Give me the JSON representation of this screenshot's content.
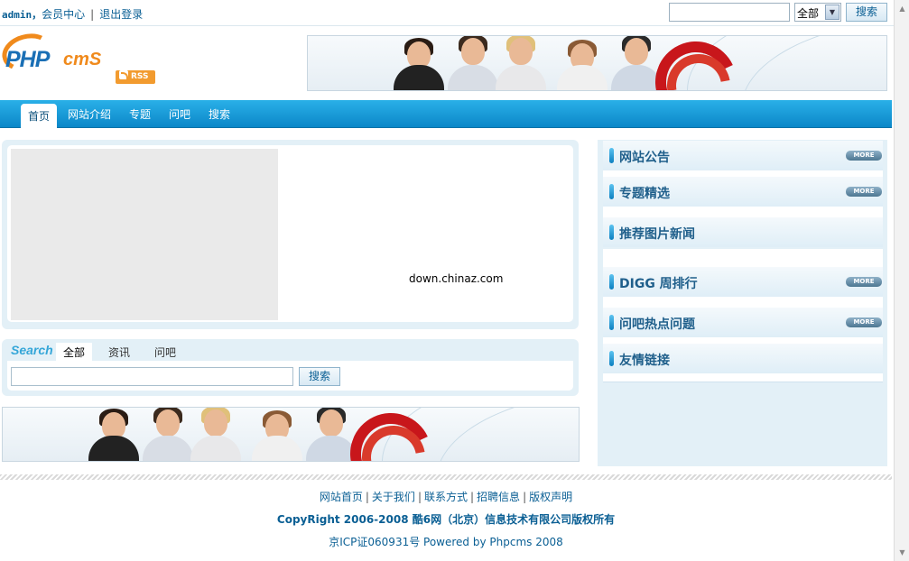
{
  "topbar": {
    "username": "admin，",
    "member_center": "会员中心",
    "separator": "|",
    "logout": "退出登录",
    "search_value": "",
    "scope_select": "全部",
    "search_button": "搜索"
  },
  "header": {
    "logo_php": "PHP",
    "logo_cms": "cmS",
    "rss_label": "RSS"
  },
  "nav": {
    "tabs": [
      "首页",
      "网站介绍",
      "专题",
      "问吧",
      "搜索"
    ],
    "active": "首页"
  },
  "slide": {
    "watermark": "down.chinaz.com"
  },
  "search": {
    "title": "Search",
    "tabs": [
      "全部",
      "资讯",
      "问吧"
    ],
    "input_value": "",
    "button": "搜索"
  },
  "sidebar": {
    "boxes": [
      {
        "title": "网站公告",
        "more": "MORE"
      },
      {
        "title": "专题精选",
        "more": "MORE"
      },
      {
        "title": "推荐图片新闻"
      },
      {
        "title": "DIGG 周排行",
        "more": "MORE"
      },
      {
        "title": "问吧热点问题",
        "more": "MORE"
      },
      {
        "title": "友情链接"
      }
    ]
  },
  "footer": {
    "links": [
      "网站首页",
      "关于我们",
      "联系方式",
      "招聘信息",
      "版权声明"
    ],
    "link_sep": "|",
    "copyright": "CopyRight 2006-2008 酷6网（北京）信息技术有限公司版权所有",
    "icp": "京ICP证060931号  Powered by Phpcms 2008"
  },
  "colors": {
    "nav_blue": "#0b87c8",
    "link_blue": "#0a5f94",
    "panel_bg": "#e3f0f7",
    "logo_orange": "#f08a1c"
  }
}
